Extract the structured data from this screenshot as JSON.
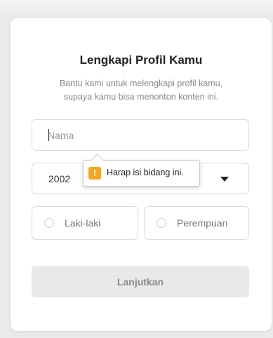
{
  "profile_form": {
    "title": "Lengkapi Profil Kamu",
    "subtitle_line1": "Bantu kami untuk melengkapi profil kamu,",
    "subtitle_line2": "supaya kamu bisa menonton konten ini.",
    "name_field": {
      "placeholder": "Nama",
      "value": ""
    },
    "birth_year": {
      "selected": "2002"
    },
    "gender_options": [
      {
        "label": "Laki-laki",
        "checked": false
      },
      {
        "label": "Perempuan",
        "checked": false
      }
    ],
    "submit_label": "Lanjutkan",
    "submit_disabled": true
  },
  "validation_tooltip": {
    "icon": "warning-icon",
    "icon_glyph": "!",
    "message": "Harap isi bidang ini.",
    "color": "#f5a623"
  },
  "colors": {
    "backdrop": "#e9eaec",
    "card": "#ffffff",
    "disabled_button": "#e9e9e9",
    "border": "#dcdcdc"
  }
}
